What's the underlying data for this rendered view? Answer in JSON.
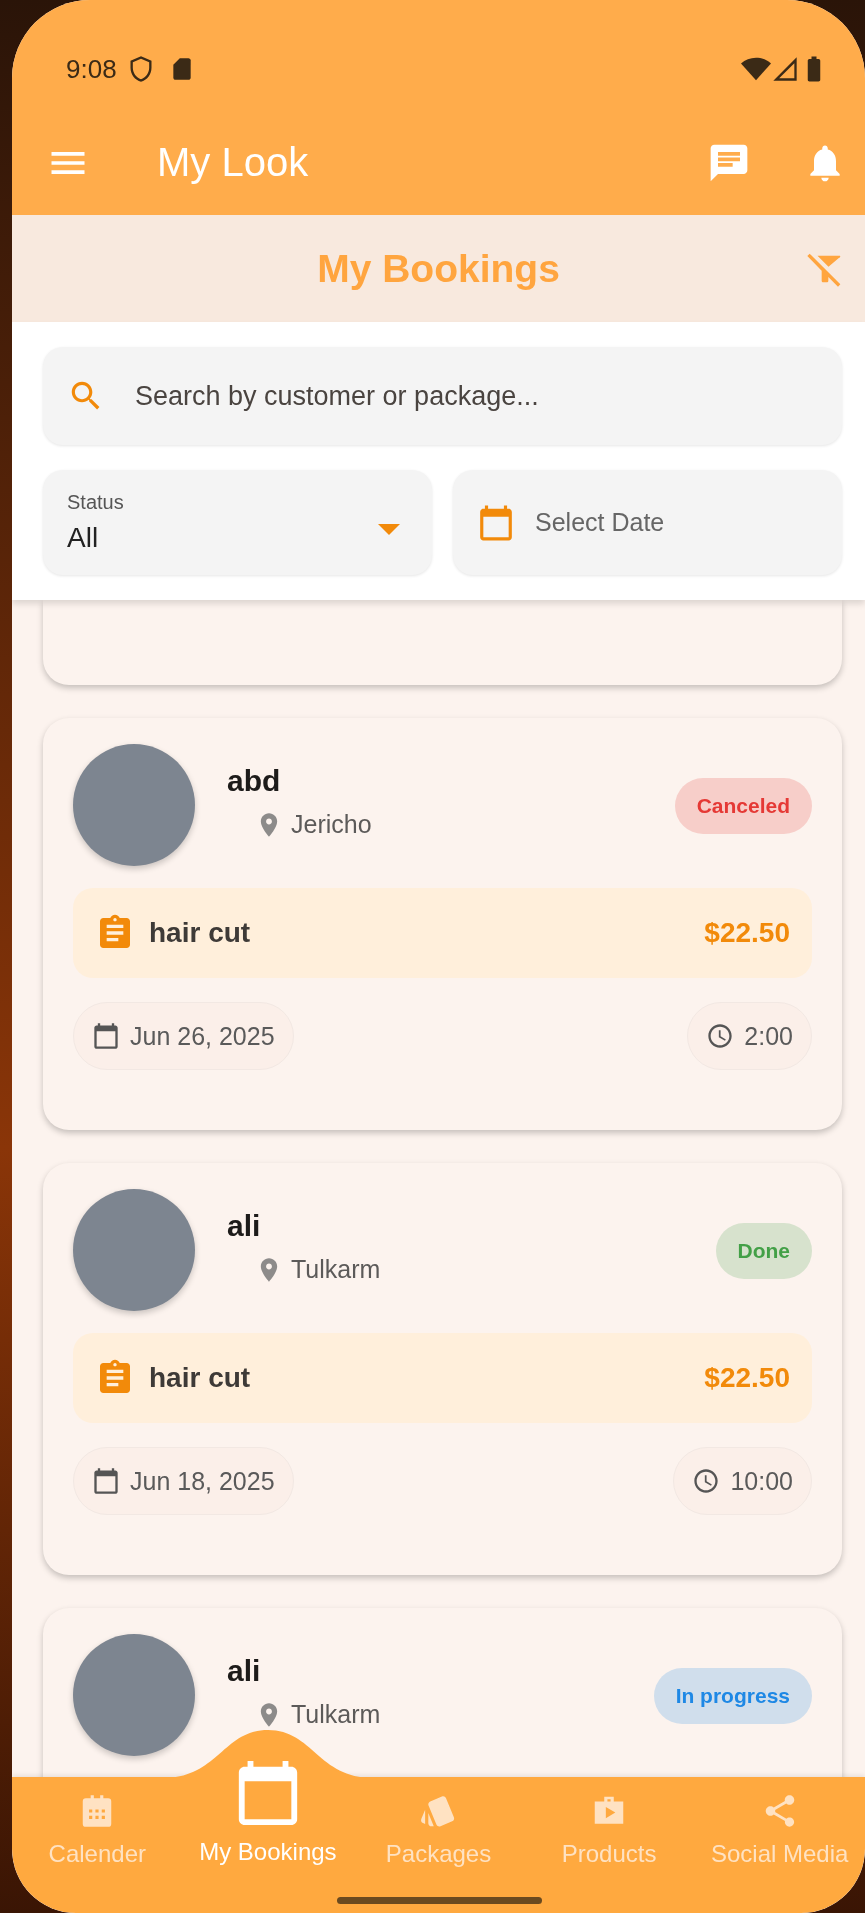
{
  "status_bar": {
    "time": "9:08"
  },
  "app_bar": {
    "title": "My Look"
  },
  "page_header": {
    "title": "My Bookings"
  },
  "filters": {
    "search": {
      "placeholder": "Search by customer or package..."
    },
    "status": {
      "label": "Status",
      "value": "All"
    },
    "date": {
      "placeholder": "Select Date"
    }
  },
  "bookings": [
    {
      "name": "abd",
      "location": "Jericho",
      "status": "Canceled",
      "color": "#e53935",
      "package": "hair cut",
      "price": "$22.50",
      "date": "Jun 26, 2025",
      "time": "2:00"
    },
    {
      "name": "ali",
      "location": "Tulkarm",
      "status": "Done",
      "color": "#43a047",
      "package": "hair cut",
      "price": "$22.50",
      "date": "Jun 18, 2025",
      "time": "10:00"
    },
    {
      "name": "ali",
      "location": "Tulkarm",
      "status": "In progress",
      "color": "#1e88e5"
    }
  ],
  "bottom_nav": [
    {
      "label": "Calender",
      "kind": "calendar-grid",
      "selected": false
    },
    {
      "label": "My Bookings",
      "kind": "calendar",
      "selected": true
    },
    {
      "label": "Packages",
      "kind": "cards",
      "selected": false
    },
    {
      "label": "Products",
      "kind": "briefcase",
      "selected": false
    },
    {
      "label": "Social Media",
      "kind": "share",
      "selected": false
    }
  ]
}
